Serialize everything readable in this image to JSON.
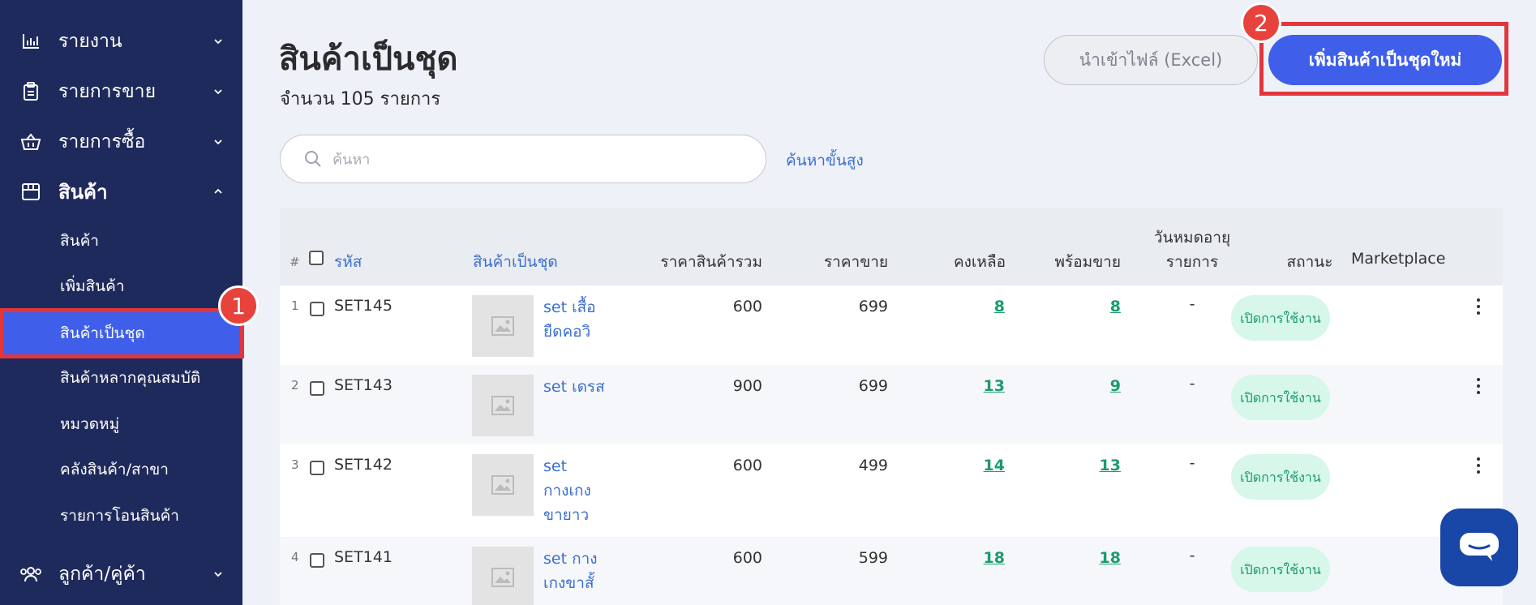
{
  "sidebar": {
    "items": [
      {
        "label": "รายงาน",
        "icon": "bar-chart-icon"
      },
      {
        "label": "รายการขาย",
        "icon": "clipboard-icon"
      },
      {
        "label": "รายการซื้อ",
        "icon": "basket-icon"
      },
      {
        "label": "สินค้า",
        "icon": "box-icon"
      },
      {
        "label": "ลูกค้า/คู่ค้า",
        "icon": "users-icon"
      }
    ],
    "sub_items": [
      "สินค้า",
      "เพิ่มสินค้า",
      "สินค้าเป็นชุด",
      "สินค้าหลากคุณสมบัติ",
      "หมวดหมู่",
      "คลังสินค้า/สาขา",
      "รายการโอนสินค้า"
    ]
  },
  "annotations": {
    "step1": "1",
    "step2": "2"
  },
  "header": {
    "title": "สินค้าเป็นชุด",
    "count": "จำนวน 105 รายการ",
    "import_label": "นำเข้าไฟล์ (Excel)",
    "add_label": "เพิ่มสินค้าเป็นชุดใหม่"
  },
  "search": {
    "placeholder": "ค้นหา",
    "advanced_label": "ค้นหาขั้นสูง"
  },
  "table": {
    "headers": {
      "index": "#",
      "code": "รหัส",
      "name": "สินค้าเป็นชุด",
      "total_price": "ราคาสินค้ารวม",
      "sale_price": "ราคาขาย",
      "remaining": "คงเหลือ",
      "ready": "พร้อมขาย",
      "expiry_line1": "วันหมดอายุ",
      "expiry_line2": "รายการ",
      "status": "สถานะ",
      "marketplace": "Marketplace"
    },
    "rows": [
      {
        "index": "1",
        "code": "SET145",
        "name": "set เสื้อยืดคอวิ",
        "total_price": "600",
        "sale_price": "699",
        "remaining": "8",
        "ready": "8",
        "expiry": "-",
        "status": "เปิดการใช้งาน"
      },
      {
        "index": "2",
        "code": "SET143",
        "name": "set เดรส",
        "total_price": "900",
        "sale_price": "699",
        "remaining": "13",
        "ready": "9",
        "expiry": "-",
        "status": "เปิดการใช้งาน"
      },
      {
        "index": "3",
        "code": "SET142",
        "name": "set กางเกงขายาว",
        "total_price": "600",
        "sale_price": "499",
        "remaining": "14",
        "ready": "13",
        "expiry": "-",
        "status": "เปิดการใช้งาน"
      },
      {
        "index": "4",
        "code": "SET141",
        "name": "set กางเกงขาสั้",
        "total_price": "600",
        "sale_price": "599",
        "remaining": "18",
        "ready": "18",
        "expiry": "-",
        "status": "เปิดการใช้งาน"
      }
    ]
  },
  "colors": {
    "sidebar": "#1f2a5c",
    "accent": "#3f5fea",
    "highlight": "#e1363c",
    "success": "#1a9c6b"
  }
}
